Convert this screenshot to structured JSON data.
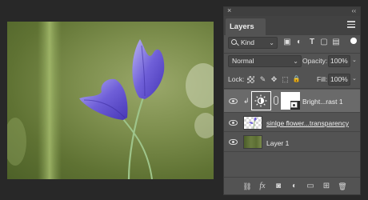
{
  "panel": {
    "close_glyph": "×",
    "collapse_glyph": "‹‹",
    "tab_label": "Layers",
    "menu_icon": "hamburger-menu-icon"
  },
  "filter": {
    "kind_label": "Kind",
    "filter_icons": [
      "image-filter-icon",
      "adjustment-filter-icon",
      "type-filter-icon",
      "shape-filter-icon",
      "smart-object-filter-icon"
    ],
    "filter_glyphs": [
      "▣",
      "◐",
      "T",
      "▢",
      "▤"
    ]
  },
  "blend": {
    "mode": "Normal",
    "opacity_label": "Opacity:",
    "opacity_value": "100%"
  },
  "lock": {
    "label": "Lock:",
    "icons": [
      "lock-transparent-icon",
      "lock-image-icon",
      "lock-position-icon",
      "lock-artboard-icon",
      "lock-all-icon"
    ],
    "glyphs": [
      "",
      "✎",
      "✥",
      "⬚",
      "🔒"
    ],
    "fill_label": "Fill:",
    "fill_value": "100%"
  },
  "layers": [
    {
      "name": "Bright...rast 1",
      "type": "adjustment",
      "visible": true,
      "selected": true
    },
    {
      "name": "sinlge flower...transparency",
      "type": "pixel",
      "visible": true,
      "selected": false
    },
    {
      "name": "Layer 1",
      "type": "pixel",
      "visible": true,
      "selected": false
    }
  ],
  "toolbar": {
    "icons": [
      "link-layers-icon",
      "layer-style-fx-icon",
      "add-mask-icon",
      "new-adjustment-icon",
      "new-group-icon",
      "new-layer-icon",
      "delete-layer-icon"
    ],
    "glyphs": [
      "⛓",
      "fx",
      "◙",
      "◐",
      "▭",
      "⊞",
      "🗑"
    ]
  },
  "colors": {
    "panel_bg": "#535353",
    "selected_row": "#6a6a6a",
    "app_bg": "#282828",
    "flower_purple": "#7a6fd6"
  }
}
